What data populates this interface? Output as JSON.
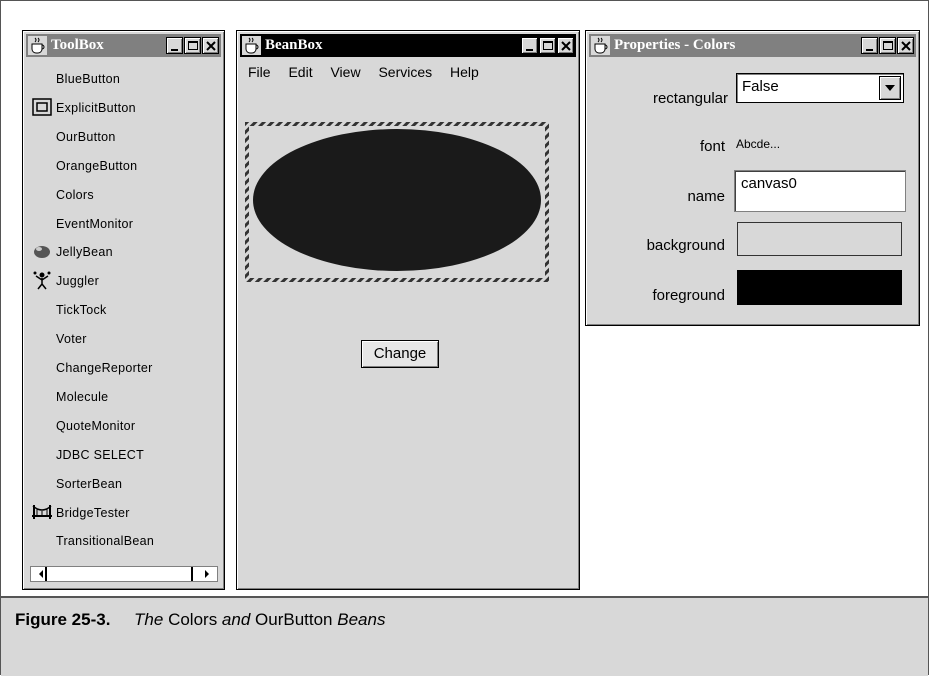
{
  "toolbox": {
    "title": "ToolBox",
    "items": [
      {
        "label": "BlueButton",
        "icon": "none"
      },
      {
        "label": "ExplicitButton",
        "icon": "button-frame-icon"
      },
      {
        "label": "OurButton",
        "icon": "none"
      },
      {
        "label": "OrangeButton",
        "icon": "none"
      },
      {
        "label": "Colors",
        "icon": "none"
      },
      {
        "label": "EventMonitor",
        "icon": "none"
      },
      {
        "label": "JellyBean",
        "icon": "jellybean-icon"
      },
      {
        "label": "Juggler",
        "icon": "juggler-icon"
      },
      {
        "label": "TickTock",
        "icon": "none"
      },
      {
        "label": "Voter",
        "icon": "none"
      },
      {
        "label": "ChangeReporter",
        "icon": "none"
      },
      {
        "label": "Molecule",
        "icon": "none"
      },
      {
        "label": "QuoteMonitor",
        "icon": "none"
      },
      {
        "label": "JDBC SELECT",
        "icon": "none"
      },
      {
        "label": "SorterBean",
        "icon": "none"
      },
      {
        "label": "BridgeTester",
        "icon": "bridge-icon"
      },
      {
        "label": "TransitionalBean",
        "icon": "none"
      }
    ]
  },
  "beanbox": {
    "title": "BeanBox",
    "menu": [
      "File",
      "Edit",
      "View",
      "Services",
      "Help"
    ],
    "change_button": "Change",
    "canvas_color": "#1a1a1a"
  },
  "properties": {
    "title": "Properties - Colors",
    "rectangular_label": "rectangular",
    "rectangular_value": "False",
    "font_label": "font",
    "font_value": "Abcde...",
    "name_label": "name",
    "name_value": "canvas0",
    "background_label": "background",
    "background_color": "#d8d8d8",
    "foreground_label": "foreground",
    "foreground_color": "#000000"
  },
  "caption": {
    "figure": "Figure 25-3.",
    "text_parts": [
      "The ",
      "Colors",
      " and ",
      "OurButton",
      " Beans"
    ]
  }
}
